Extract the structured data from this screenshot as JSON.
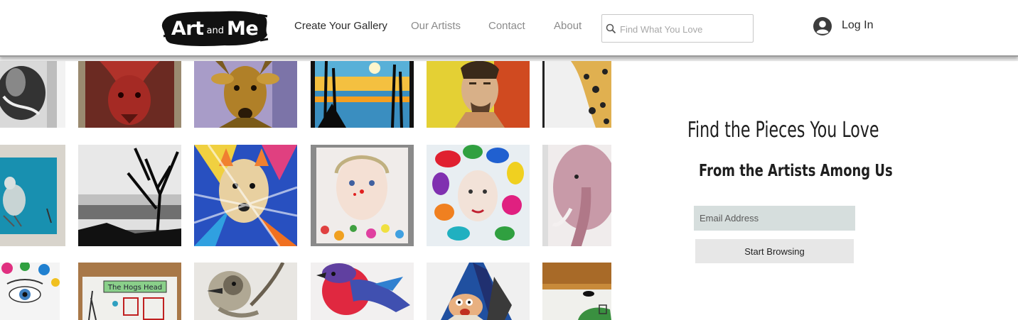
{
  "logo": {
    "word1": "Art",
    "word2": "and",
    "word3": "Me"
  },
  "nav": {
    "items": [
      {
        "label": "Create Your Gallery"
      },
      {
        "label": "Our Artists"
      },
      {
        "label": "Contact"
      },
      {
        "label": "About"
      }
    ]
  },
  "search": {
    "placeholder": "Find What You Love",
    "icon": "search-icon"
  },
  "auth": {
    "login_label": "Log In",
    "icon": "avatar-icon"
  },
  "hero": {
    "headline": "Find the Pieces You Love",
    "subheadline": "From the Artists Among Us",
    "email_placeholder": "Email Address",
    "button_label": "Start Browsing"
  },
  "gallery": {
    "artworks": [
      "rabbit-sketch",
      "red-dragon",
      "deer-portrait",
      "sunset-lake",
      "man-portrait",
      "leopard",
      "blue-duck",
      "black-white-tree",
      "colorful-fox",
      "girl-watercolor",
      "colorful-woman",
      "pink-elephant",
      "eye-painting",
      "the-hogs-head-sign",
      "kookaburra-sketch",
      "robin-bird",
      "gnome-rock",
      "wooden-landscape"
    ],
    "hogs_head_sign_text": "The Hogs Head"
  },
  "colors": {
    "text_dark": "#1e1e1e",
    "nav_muted": "#8b8b8b",
    "input_bg": "#d6dedd",
    "button_bg": "#e7e7e7"
  }
}
